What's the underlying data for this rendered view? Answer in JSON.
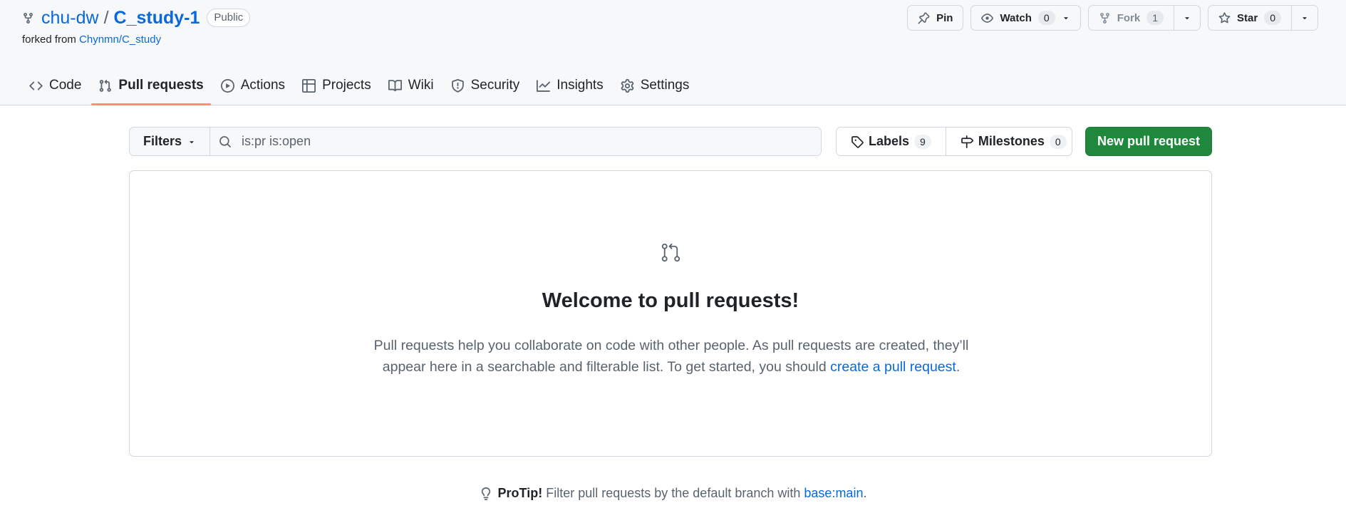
{
  "repo": {
    "owner": "chu-dw",
    "separator": "/",
    "name": "C_study-1",
    "visibility": "Public",
    "forked_prefix": "forked from",
    "forked_source": "Chynmn/C_study"
  },
  "actions": {
    "pin_label": "Pin",
    "watch_label": "Watch",
    "watch_count": "0",
    "fork_label": "Fork",
    "fork_count": "1",
    "star_label": "Star",
    "star_count": "0"
  },
  "nav": {
    "tabs": [
      {
        "label": "Code",
        "icon": "code-icon"
      },
      {
        "label": "Pull requests",
        "icon": "git-pull-request-icon"
      },
      {
        "label": "Actions",
        "icon": "play-icon"
      },
      {
        "label": "Projects",
        "icon": "table-icon"
      },
      {
        "label": "Wiki",
        "icon": "book-icon"
      },
      {
        "label": "Security",
        "icon": "shield-icon"
      },
      {
        "label": "Insights",
        "icon": "graph-icon"
      },
      {
        "label": "Settings",
        "icon": "gear-icon"
      }
    ],
    "selected": "Pull requests"
  },
  "subnav": {
    "filters_label": "Filters",
    "search_value": "is:pr is:open",
    "labels_label": "Labels",
    "labels_count": "9",
    "milestones_label": "Milestones",
    "milestones_count": "0",
    "new_pr_label": "New pull request"
  },
  "blankslate": {
    "title": "Welcome to pull requests!",
    "text_1": "Pull requests help you collaborate on code with other people. As pull requests are created, they’ll appear here in a searchable and filterable list. To get started, you should",
    "link": "create a pull request",
    "text_end": "."
  },
  "protip": {
    "label": "ProTip!",
    "text": "Filter pull requests by the default branch with",
    "link": "base:main",
    "end": "."
  },
  "colors": {
    "accent": "#0969da",
    "primary_button": "#1f883d",
    "tab_underline": "#fd8c73",
    "border": "#d0d7de",
    "header_bg": "#f6f8fa"
  }
}
